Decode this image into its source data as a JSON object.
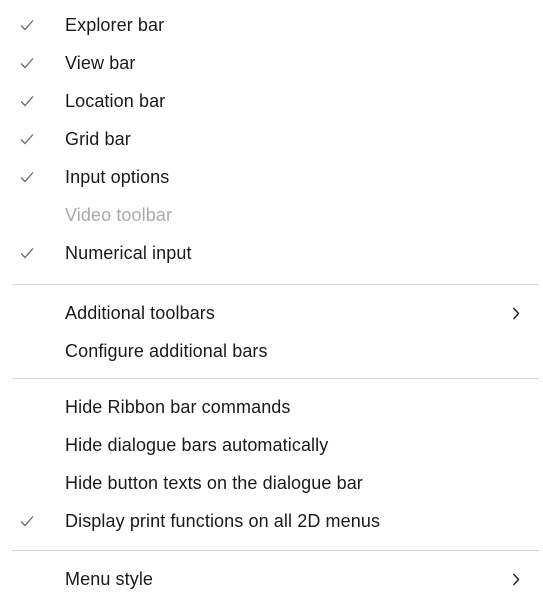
{
  "menu": {
    "items": [
      {
        "label": "Explorer bar",
        "checked": true
      },
      {
        "label": "View bar",
        "checked": true
      },
      {
        "label": "Location bar",
        "checked": true
      },
      {
        "label": "Grid bar",
        "checked": true
      },
      {
        "label": "Input options",
        "checked": true
      },
      {
        "label": "Video toolbar",
        "checked": false,
        "disabled": true
      },
      {
        "label": "Numerical input",
        "checked": true
      },
      {
        "label": "Additional toolbars",
        "checked": false,
        "submenu": true
      },
      {
        "label": "Configure additional bars",
        "checked": false
      },
      {
        "label": "Hide Ribbon bar commands",
        "checked": false
      },
      {
        "label": "Hide dialogue bars automatically",
        "checked": false
      },
      {
        "label": "Hide button texts on the dialogue bar",
        "checked": false
      },
      {
        "label": "Display print functions on all 2D menus",
        "checked": true
      },
      {
        "label": "Menu style",
        "checked": false,
        "submenu": true
      }
    ]
  },
  "colors": {
    "text": "#1a1a1a",
    "disabled_text": "#a9a9a9",
    "separator": "#d9d9d9",
    "check": "#6b6b6b"
  },
  "icons": {
    "check": "checkmark-icon",
    "submenu": "chevron-right-icon"
  }
}
